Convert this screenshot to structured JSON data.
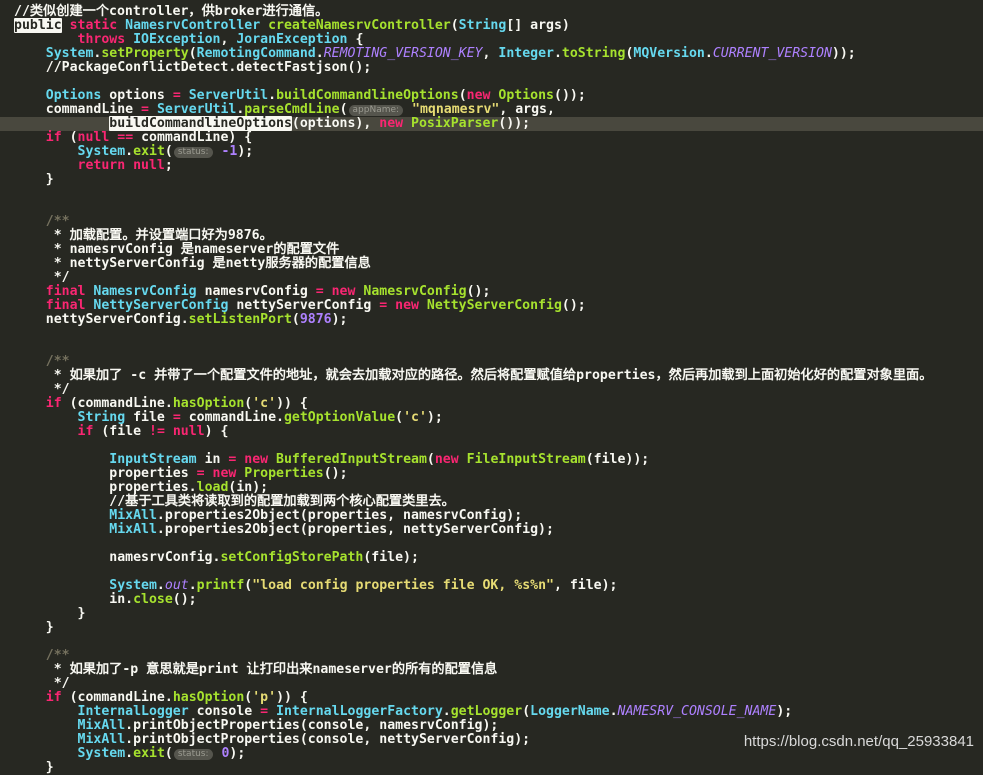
{
  "watermark": "https://blog.csdn.net/qq_25933841",
  "colors": {
    "background": "#272822",
    "keyword": "#f92672",
    "type": "#66d9ef",
    "function": "#a6e22e",
    "string": "#e6db74",
    "number": "#ae81ff",
    "plain": "#f8f8f2",
    "current_line": "#49483e"
  },
  "lines": [
    {
      "t": [
        [
          "cm",
          "//类似创建一个controller，供broker进行通信。"
        ]
      ]
    },
    {
      "t": [
        [
          "sel",
          "public"
        ],
        [
          "kw",
          " static "
        ],
        [
          "type",
          "NamesrvController "
        ],
        [
          "fn",
          "createNamesrvController"
        ],
        [
          "plain",
          "("
        ],
        [
          "type",
          "String"
        ],
        [
          "plain",
          "[] args)"
        ]
      ]
    },
    {
      "t": [
        [
          "plain",
          "        "
        ],
        [
          "kw",
          "throws "
        ],
        [
          "type",
          "IOException"
        ],
        [
          "plain",
          ", "
        ],
        [
          "type",
          "JoranException "
        ],
        [
          "plain",
          "{"
        ]
      ]
    },
    {
      "t": [
        [
          "plain",
          "    "
        ],
        [
          "type",
          "System"
        ],
        [
          "plain",
          "."
        ],
        [
          "fn",
          "setProperty"
        ],
        [
          "plain",
          "("
        ],
        [
          "type",
          "RemotingCommand"
        ],
        [
          "plain",
          "."
        ],
        [
          "const",
          "REMOTING_VERSION_KEY"
        ],
        [
          "plain",
          ", "
        ],
        [
          "type",
          "Integer"
        ],
        [
          "plain",
          "."
        ],
        [
          "fn",
          "toString"
        ],
        [
          "plain",
          "("
        ],
        [
          "type",
          "MQVersion"
        ],
        [
          "plain",
          "."
        ],
        [
          "const",
          "CURRENT_VERSION"
        ],
        [
          "plain",
          "));"
        ]
      ]
    },
    {
      "t": [
        [
          "plain",
          "    //PackageConflictDetect.detectFastjson();"
        ]
      ]
    },
    {
      "t": []
    },
    {
      "t": [
        [
          "plain",
          "    "
        ],
        [
          "type",
          "Options "
        ],
        [
          "plain",
          "options "
        ],
        [
          "op",
          "= "
        ],
        [
          "type",
          "ServerUtil"
        ],
        [
          "plain",
          "."
        ],
        [
          "fn",
          "buildCommandlineOptions"
        ],
        [
          "plain",
          "("
        ],
        [
          "kw",
          "new "
        ],
        [
          "fn",
          "Options"
        ],
        [
          "plain",
          "());"
        ]
      ]
    },
    {
      "t": [
        [
          "plain",
          "    commandLine "
        ],
        [
          "op",
          "= "
        ],
        [
          "type",
          "ServerUtil"
        ],
        [
          "plain",
          "."
        ],
        [
          "fn",
          "parseCmdLine"
        ],
        [
          "plain",
          "("
        ],
        [
          "hint",
          "appName:"
        ],
        [
          "str",
          " \"mqnamesrv\""
        ],
        [
          "plain",
          ", args,"
        ]
      ]
    },
    {
      "hl": true,
      "t": [
        [
          "plain",
          "            "
        ],
        [
          "sel",
          "buildCommandlineOptions"
        ],
        [
          "plain",
          "(options), "
        ],
        [
          "kw",
          "new "
        ],
        [
          "fn",
          "PosixParser"
        ],
        [
          "plain",
          "());"
        ]
      ]
    },
    {
      "t": [
        [
          "plain",
          "    "
        ],
        [
          "kw",
          "if "
        ],
        [
          "plain",
          "("
        ],
        [
          "kw",
          "null "
        ],
        [
          "op",
          "== "
        ],
        [
          "plain",
          "commandLine) {"
        ]
      ]
    },
    {
      "t": [
        [
          "plain",
          "        "
        ],
        [
          "type",
          "System"
        ],
        [
          "plain",
          "."
        ],
        [
          "fn",
          "exit"
        ],
        [
          "plain",
          "("
        ],
        [
          "hint",
          "status:"
        ],
        [
          "num",
          " -1"
        ],
        [
          "plain",
          ");"
        ]
      ]
    },
    {
      "t": [
        [
          "plain",
          "        "
        ],
        [
          "kw",
          "return null"
        ],
        [
          "plain",
          ";"
        ]
      ]
    },
    {
      "t": [
        [
          "plain",
          "    }"
        ]
      ]
    },
    {
      "t": []
    },
    {
      "t": []
    },
    {
      "t": [
        [
          "plain",
          "    "
        ],
        [
          "cmstar",
          "/**"
        ]
      ]
    },
    {
      "t": [
        [
          "plain",
          "     * 加载配置。并设置端口好为9876。"
        ]
      ]
    },
    {
      "t": [
        [
          "plain",
          "     * namesrvConfig 是nameserver的配置文件"
        ]
      ]
    },
    {
      "t": [
        [
          "plain",
          "     * nettyServerConfig 是netty服务器的配置信息"
        ]
      ]
    },
    {
      "t": [
        [
          "plain",
          "     */"
        ]
      ]
    },
    {
      "t": [
        [
          "plain",
          "    "
        ],
        [
          "kw",
          "final "
        ],
        [
          "type",
          "NamesrvConfig "
        ],
        [
          "plain",
          "namesrvConfig "
        ],
        [
          "op",
          "= "
        ],
        [
          "kw",
          "new "
        ],
        [
          "fn",
          "NamesrvConfig"
        ],
        [
          "plain",
          "();"
        ]
      ]
    },
    {
      "t": [
        [
          "plain",
          "    "
        ],
        [
          "kw",
          "final "
        ],
        [
          "type",
          "NettyServerConfig "
        ],
        [
          "plain",
          "nettyServerConfig "
        ],
        [
          "op",
          "= "
        ],
        [
          "kw",
          "new "
        ],
        [
          "fn",
          "NettyServerConfig"
        ],
        [
          "plain",
          "();"
        ]
      ]
    },
    {
      "t": [
        [
          "plain",
          "    nettyServerConfig."
        ],
        [
          "fn",
          "setListenPort"
        ],
        [
          "plain",
          "("
        ],
        [
          "num",
          "9876"
        ],
        [
          "plain",
          ");"
        ]
      ]
    },
    {
      "t": []
    },
    {
      "t": []
    },
    {
      "t": [
        [
          "plain",
          "    "
        ],
        [
          "cmstar",
          "/**"
        ]
      ]
    },
    {
      "t": [
        [
          "plain",
          "     * 如果加了 -c 并带了一个配置文件的地址，就会去加载对应的路径。然后将配置赋值给properties，然后再加载到上面初始化好的配置对象里面。"
        ]
      ]
    },
    {
      "t": [
        [
          "plain",
          "     */"
        ]
      ]
    },
    {
      "t": [
        [
          "plain",
          "    "
        ],
        [
          "kw",
          "if "
        ],
        [
          "plain",
          "(commandLine."
        ],
        [
          "fn",
          "hasOption"
        ],
        [
          "plain",
          "("
        ],
        [
          "str",
          "'c'"
        ],
        [
          "plain",
          ")) {"
        ]
      ]
    },
    {
      "t": [
        [
          "plain",
          "        "
        ],
        [
          "type",
          "String "
        ],
        [
          "plain",
          "file "
        ],
        [
          "op",
          "= "
        ],
        [
          "plain",
          "commandLine."
        ],
        [
          "fn",
          "getOptionValue"
        ],
        [
          "plain",
          "("
        ],
        [
          "str",
          "'c'"
        ],
        [
          "plain",
          ");"
        ]
      ]
    },
    {
      "t": [
        [
          "plain",
          "        "
        ],
        [
          "kw",
          "if "
        ],
        [
          "plain",
          "(file "
        ],
        [
          "op",
          "!= "
        ],
        [
          "kw",
          "null"
        ],
        [
          "plain",
          ") {"
        ]
      ]
    },
    {
      "t": []
    },
    {
      "t": [
        [
          "plain",
          "            "
        ],
        [
          "type",
          "InputStream "
        ],
        [
          "plain",
          "in "
        ],
        [
          "op",
          "= "
        ],
        [
          "kw",
          "new "
        ],
        [
          "fn",
          "BufferedInputStream"
        ],
        [
          "plain",
          "("
        ],
        [
          "kw",
          "new "
        ],
        [
          "fn",
          "FileInputStream"
        ],
        [
          "plain",
          "(file));"
        ]
      ]
    },
    {
      "t": [
        [
          "plain",
          "            properties "
        ],
        [
          "op",
          "= "
        ],
        [
          "kw",
          "new "
        ],
        [
          "fn",
          "Properties"
        ],
        [
          "plain",
          "();"
        ]
      ]
    },
    {
      "t": [
        [
          "plain",
          "            properties."
        ],
        [
          "fn",
          "load"
        ],
        [
          "plain",
          "(in);"
        ]
      ]
    },
    {
      "t": [
        [
          "plain",
          "            //基于工具类将读取到的配置加载到两个核心配置类里去。"
        ]
      ]
    },
    {
      "t": [
        [
          "plain",
          "            "
        ],
        [
          "type",
          "MixAll"
        ],
        [
          "plain",
          "."
        ],
        [
          "plain",
          "properties2Object(properties, namesrvConfig);"
        ]
      ]
    },
    {
      "t": [
        [
          "plain",
          "            "
        ],
        [
          "type",
          "MixAll"
        ],
        [
          "plain",
          "."
        ],
        [
          "plain",
          "properties2Object(properties, nettyServerConfig);"
        ]
      ]
    },
    {
      "t": []
    },
    {
      "t": [
        [
          "plain",
          "            namesrvConfig."
        ],
        [
          "fn",
          "setConfigStorePath"
        ],
        [
          "plain",
          "(file);"
        ]
      ]
    },
    {
      "t": []
    },
    {
      "t": [
        [
          "plain",
          "            "
        ],
        [
          "type",
          "System"
        ],
        [
          "plain",
          "."
        ],
        [
          "field",
          "out"
        ],
        [
          "plain",
          "."
        ],
        [
          "fn",
          "printf"
        ],
        [
          "plain",
          "("
        ],
        [
          "str",
          "\"load config properties file OK, %s%n\""
        ],
        [
          "plain",
          ", file);"
        ]
      ]
    },
    {
      "t": [
        [
          "plain",
          "            in."
        ],
        [
          "fn",
          "close"
        ],
        [
          "plain",
          "();"
        ]
      ]
    },
    {
      "t": [
        [
          "plain",
          "        }"
        ]
      ]
    },
    {
      "t": [
        [
          "plain",
          "    }"
        ]
      ]
    },
    {
      "t": []
    },
    {
      "t": [
        [
          "plain",
          "    "
        ],
        [
          "cmstar",
          "/**"
        ]
      ]
    },
    {
      "t": [
        [
          "plain",
          "     * 如果加了-p 意思就是print 让打印出来nameserver的所有的配置信息"
        ]
      ]
    },
    {
      "t": [
        [
          "plain",
          "     */"
        ]
      ]
    },
    {
      "t": [
        [
          "plain",
          "    "
        ],
        [
          "kw",
          "if "
        ],
        [
          "plain",
          "(commandLine."
        ],
        [
          "fn",
          "hasOption"
        ],
        [
          "plain",
          "("
        ],
        [
          "str",
          "'p'"
        ],
        [
          "plain",
          ")) {"
        ]
      ]
    },
    {
      "t": [
        [
          "plain",
          "        "
        ],
        [
          "type",
          "InternalLogger "
        ],
        [
          "plain",
          "console "
        ],
        [
          "op",
          "= "
        ],
        [
          "type",
          "InternalLoggerFactory"
        ],
        [
          "plain",
          "."
        ],
        [
          "fn",
          "getLogger"
        ],
        [
          "plain",
          "("
        ],
        [
          "type",
          "LoggerName"
        ],
        [
          "plain",
          "."
        ],
        [
          "const",
          "NAMESRV_CONSOLE_NAME"
        ],
        [
          "plain",
          ");"
        ]
      ]
    },
    {
      "t": [
        [
          "plain",
          "        "
        ],
        [
          "type",
          "MixAll"
        ],
        [
          "plain",
          "."
        ],
        [
          "plain",
          "printObjectProperties(console, namesrvConfig);"
        ]
      ]
    },
    {
      "t": [
        [
          "plain",
          "        "
        ],
        [
          "type",
          "MixAll"
        ],
        [
          "plain",
          "."
        ],
        [
          "plain",
          "printObjectProperties(console, nettyServerConfig);"
        ]
      ]
    },
    {
      "t": [
        [
          "plain",
          "        "
        ],
        [
          "type",
          "System"
        ],
        [
          "plain",
          "."
        ],
        [
          "fn",
          "exit"
        ],
        [
          "plain",
          "("
        ],
        [
          "hint",
          "status:"
        ],
        [
          "num",
          " 0"
        ],
        [
          "plain",
          ");"
        ]
      ]
    },
    {
      "t": [
        [
          "plain",
          "    }"
        ]
      ]
    }
  ]
}
